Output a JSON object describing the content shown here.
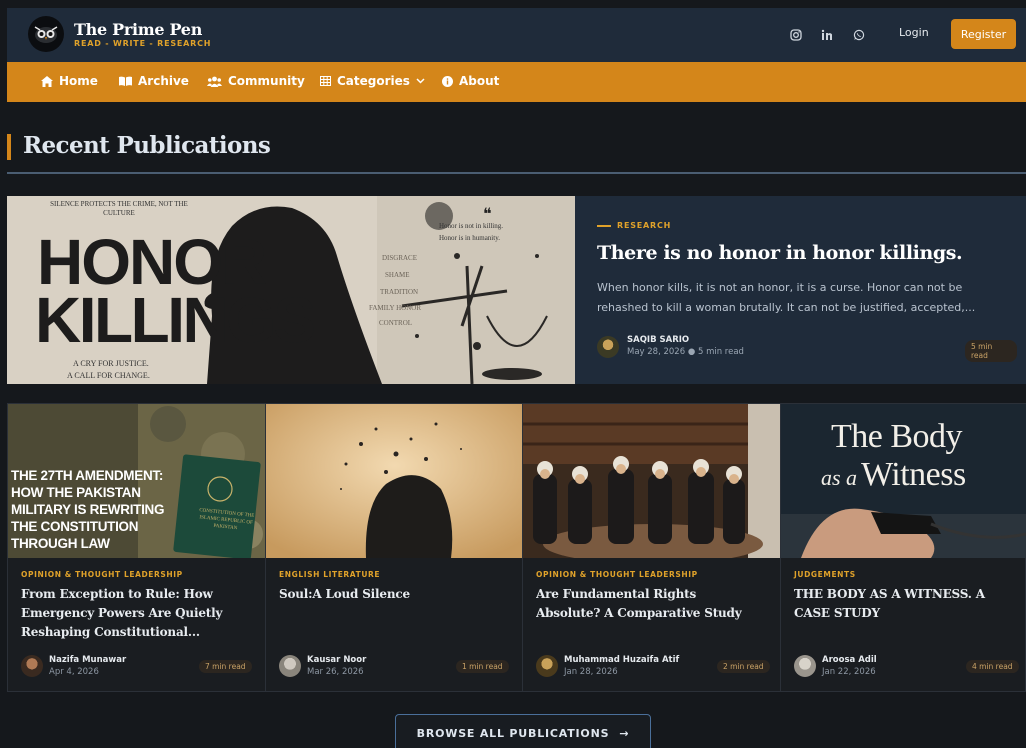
{
  "brand": {
    "title": "The Prime Pen",
    "tagline": "READ - WRITE - RESEARCH"
  },
  "header": {
    "social_icons": [
      "instagram-icon",
      "linkedin-icon",
      "whatsapp-icon"
    ],
    "login_label": "Login",
    "register_label": "Register"
  },
  "nav": {
    "items": [
      {
        "label": "Home",
        "icon": "home-icon"
      },
      {
        "label": "Archive",
        "icon": "book-icon"
      },
      {
        "label": "Community",
        "icon": "users-icon"
      },
      {
        "label": "Categories",
        "icon": "grid-icon"
      },
      {
        "label": "About",
        "icon": "info-icon"
      }
    ]
  },
  "section": {
    "title": "Recent Publications"
  },
  "featured": {
    "category": "RESEARCH",
    "title": "There is no honor in honor killings.",
    "excerpt": "When honor kills, it is not an honor, it is a curse. Honor can not be rehashed to kill a woman brutally. It can not be justified, accepted,...",
    "author": "SAQIB SARIO",
    "date": "May 28, 2026",
    "read_time_inline": "5 min read",
    "read_time_badge": "5 min read",
    "image_text": {
      "top": "SILENCE PROTECTS THE CRIME, NOT THE CULTURE",
      "headline_1": "HONOR",
      "headline_2": "KILLINGS",
      "bottom_1": "A CRY FOR JUSTICE.",
      "bottom_2": "A CALL FOR CHANGE.",
      "quote_1": "Honor is not in killing.",
      "quote_2": "Honor is in humanity.",
      "words": [
        "DISGRACE",
        "SHAME",
        "TRADITION",
        "FAMILY HONOR",
        "CONTROL"
      ]
    }
  },
  "cards": [
    {
      "category": "OPINION & THOUGHT LEADERSHIP",
      "title": "From Exception to Rule: How Emergency Powers Are Quietly Reshaping Constitutional...",
      "author": "Nazifa Munawar",
      "date": "Apr 4, 2026",
      "read_time": "7 min read",
      "image_text": "THE 27TH AMENDMENT: HOW THE PAKISTAN MILITARY IS REWRITING THE CONSTITUTION THROUGH LAW",
      "book_text": "CONSTITUTION OF THE ISLAMIC REPUBLIC OF PAKISTAN"
    },
    {
      "category": "ENGLISH LITERATURE",
      "title": "Soul:A Loud Silence",
      "author": "Kausar Noor",
      "date": "Mar 26, 2026",
      "read_time": "1 min read"
    },
    {
      "category": "OPINION & THOUGHT LEADERSHIP",
      "title": "Are Fundamental Rights Absolute? A Comparative Study",
      "author": "Muhammad Huzaifa Atif",
      "date": "Jan 28, 2026",
      "read_time": "2 min read"
    },
    {
      "category": "JUDGEMENTS",
      "title": "THE BODY AS A WITNESS. A CASE STUDY",
      "author": "Aroosa Adil",
      "date": "Jan 22, 2026",
      "read_time": "4 min read",
      "image_line_1": "The Body",
      "image_line_2a": "as a",
      "image_line_2b": "Witness"
    }
  ],
  "browse": {
    "label": "BROWSE ALL PUBLICATIONS",
    "arrow": "→"
  },
  "colors": {
    "accent": "#d4861a",
    "header_bg": "#1f2b3a",
    "page_bg": "#15181c",
    "category_text": "#e0a22a"
  }
}
